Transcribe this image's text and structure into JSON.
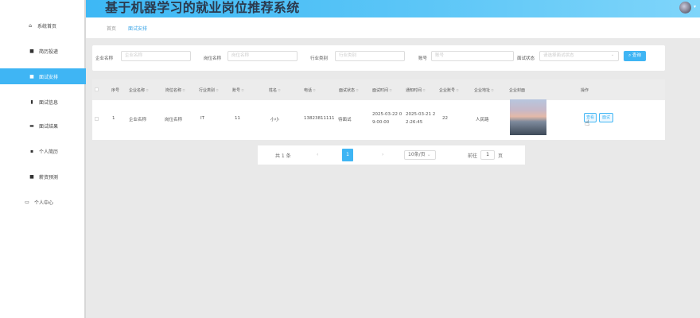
{
  "app": {
    "title": "基于机器学习的就业岗位推荐系统"
  },
  "sidebar": {
    "items": [
      {
        "label": "系统首页",
        "icon": "home-icon"
      },
      {
        "label": "简历投递",
        "icon": "grid-icon"
      },
      {
        "label": "面试安排",
        "icon": "grid-icon",
        "active": true
      },
      {
        "label": "面试信息",
        "icon": "bar-chart-icon"
      },
      {
        "label": "面试结果",
        "icon": "briefcase-icon"
      },
      {
        "label": "个人简历",
        "icon": "document-icon"
      },
      {
        "label": "薪资预测",
        "icon": "grid-icon"
      },
      {
        "label": "个人中心",
        "icon": "window-icon"
      }
    ]
  },
  "breadcrumb": {
    "home": "首页",
    "current": "面试安排"
  },
  "search": {
    "fields": [
      {
        "label": "企业名称",
        "placeholder": "企业名称"
      },
      {
        "label": "岗位名称",
        "placeholder": "岗位名称"
      },
      {
        "label": "行业类别",
        "placeholder": "行业类别"
      },
      {
        "label": "账号",
        "placeholder": "账号"
      },
      {
        "label": "面试状态",
        "placeholder": "请选择面试状态"
      }
    ],
    "button": "查询"
  },
  "table": {
    "headers": [
      "序号",
      "企业名称",
      "岗位名称",
      "行业类别",
      "账号",
      "姓名",
      "电话",
      "面试状态",
      "面试时间",
      "通知时间",
      "企业账号",
      "企业地址",
      "企业封面",
      "操作"
    ],
    "sortable": [
      false,
      true,
      true,
      true,
      true,
      true,
      true,
      true,
      true,
      true,
      true,
      true,
      false,
      false
    ],
    "rows": [
      {
        "index": "1",
        "company": "企业名称",
        "position": "岗位名称",
        "industry": "IT",
        "account": "11",
        "name": "小小",
        "phone": "13823811111",
        "status": "待面试",
        "interview_time": [
          "2025-03-22 0",
          "9:00:00"
        ],
        "notify_time": [
          "2025-03-21 2",
          "2:26:45"
        ],
        "company_account": "22",
        "address": "人民路",
        "actions": [
          "查看",
          "面试"
        ]
      }
    ]
  },
  "pagination": {
    "total": "共 1 条",
    "current": "1",
    "page_size": "10条/页",
    "goto_prefix": "前往",
    "goto_value": "1",
    "goto_suffix": "页"
  },
  "colors": {
    "accent": "#3fb5f4",
    "header_text": "#2b3a4e"
  }
}
